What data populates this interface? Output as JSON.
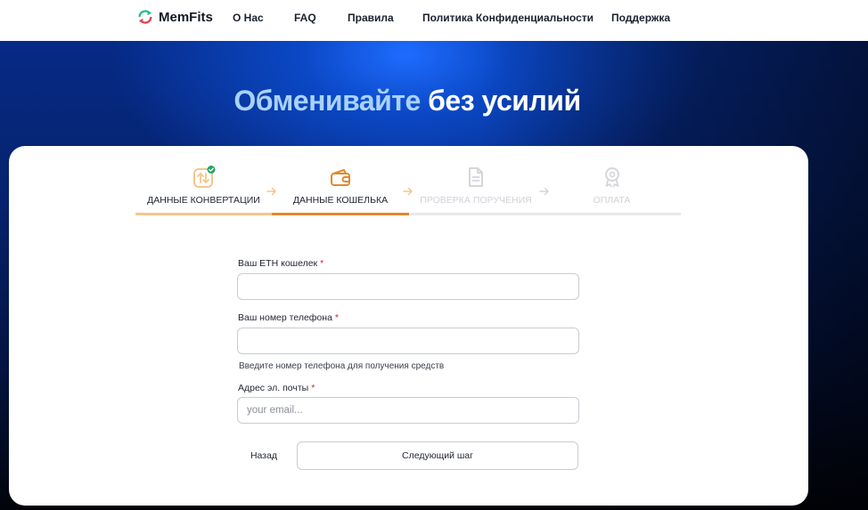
{
  "header": {
    "brand": "MemFits",
    "nav": [
      "О Нас",
      "FAQ",
      "Правила",
      "Политика Конфиденциальности",
      "Поддержка"
    ]
  },
  "hero": {
    "title_accent": "Обменивайте",
    "title_rest": "без усилий"
  },
  "steps": [
    {
      "label": "ДАННЫЕ КОНВЕРТАЦИИ",
      "icon": "exchange-icon",
      "state": "completed"
    },
    {
      "label": "ДАННЫЕ КОШЕЛЬКА",
      "icon": "wallet-icon",
      "state": "active"
    },
    {
      "label": "ПРОВЕРКА ПОРУЧЕНИЯ",
      "icon": "document-icon",
      "state": "pending"
    },
    {
      "label": "ОПЛАТА",
      "icon": "badge-icon",
      "state": "pending"
    }
  ],
  "form": {
    "eth_wallet": {
      "label": "Ваш ETH кошелек",
      "required": "*",
      "value": "",
      "placeholder": ""
    },
    "phone": {
      "label": "Ваш номер телефона",
      "required": "*",
      "value": "",
      "placeholder": "",
      "hint": "Введите номер телефона для получения средств"
    },
    "email": {
      "label": "Адрес эл. почты",
      "required": "*",
      "value": "",
      "placeholder": "your email..."
    },
    "back_label": "Назад",
    "next_label": "Следующий шаг"
  },
  "colors": {
    "accent_orange": "#e08a2c",
    "completed_orange": "#f6c58c",
    "pending_gray": "#d4d6db",
    "check_green": "#27a36b",
    "headline_accent": "#a9d2ff",
    "required_red": "#d6232a"
  }
}
